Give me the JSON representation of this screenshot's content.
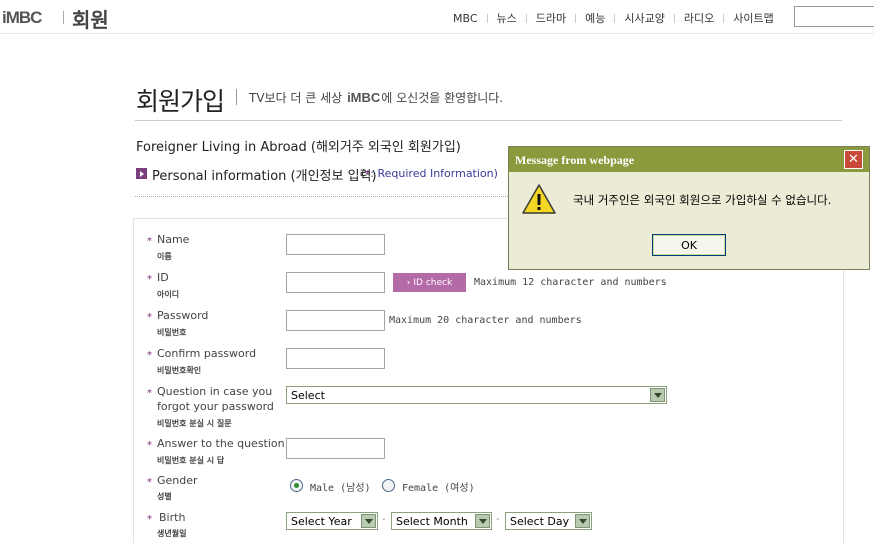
{
  "header": {
    "logo": "iMBC",
    "section": "회원",
    "nav": [
      "MBC",
      "뉴스",
      "드라마",
      "예능",
      "시사교양",
      "라디오",
      "사이트맵"
    ],
    "search_value": ""
  },
  "page": {
    "title": "회원가입",
    "subtitle_prefix": "TV보다 더 큰 세상",
    "subtitle_brand": "iMBC",
    "subtitle_suffix": "에 오신것을 환영합니다.",
    "intro": "Foreigner Living in Abroad (해외거주 외국인 회원가입)",
    "section_heading": "Personal information (개인정보 입력)",
    "required_open": "(",
    "required_star": "*",
    "required_text": ": Required Information)"
  },
  "form": {
    "required_mark": "*",
    "name": {
      "label": "Name",
      "label_ko": "이름",
      "value": ""
    },
    "id": {
      "label": "ID",
      "label_ko": "아이디",
      "value": "",
      "button": "ID check",
      "hint": "Maximum 12 character and numbers"
    },
    "password": {
      "label": "Password",
      "label_ko": "비밀번호",
      "value": "",
      "hint": "Maximum 20 character and numbers"
    },
    "confirm_password": {
      "label": "Confirm password",
      "label_ko": "비밀번호확인",
      "value": ""
    },
    "question": {
      "label_line1": "Question in case you",
      "label_line2": "forgot your password",
      "label_ko": "비밀번호 분실 시 질문",
      "selected": "Select"
    },
    "answer": {
      "label": "Answer to the question",
      "label_ko": "비밀번호 분실 시 답",
      "value": ""
    },
    "gender": {
      "label": "Gender",
      "label_ko": "성별",
      "options": [
        "Male (남성)",
        "Female (여성)"
      ],
      "selected": "Male (남성)"
    },
    "birth": {
      "label": "Birth",
      "label_ko": "생년월일",
      "year": "Select Year",
      "month": "Select Month",
      "day": "Select Day",
      "separator": "-"
    }
  },
  "dialog": {
    "title": "Message from webpage",
    "close": "✕",
    "message": "국내 거주인은 외국인 회원으로 가입하실 수 없습니다.",
    "ok": "OK",
    "icon": "warning-icon"
  }
}
